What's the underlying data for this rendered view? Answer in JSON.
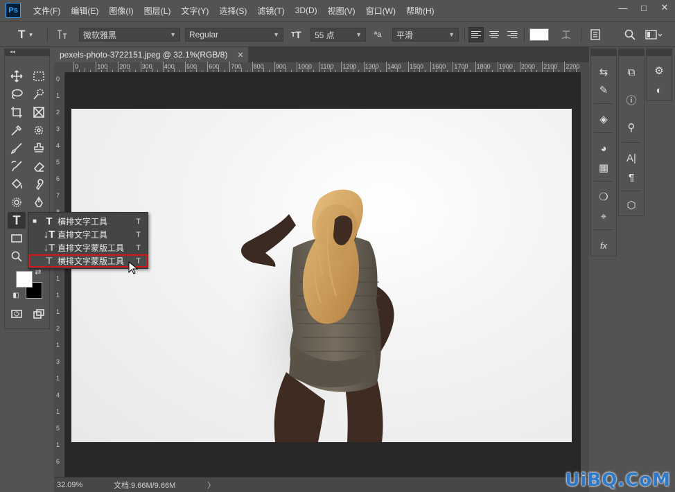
{
  "app": {
    "logo_text": "Ps"
  },
  "menu": [
    "文件(F)",
    "编辑(E)",
    "图像(I)",
    "图层(L)",
    "文字(Y)",
    "选择(S)",
    "滤镜(T)",
    "3D(D)",
    "视图(V)",
    "窗口(W)",
    "帮助(H)"
  ],
  "window_controls": {
    "minimize": "—",
    "maximize": "□",
    "close": "✕"
  },
  "options": {
    "tool_glyph": "T",
    "font_family": "微软雅黑",
    "font_style": "Regular",
    "font_size": "55 点",
    "antialias_glyph": "ªa",
    "antialias": "平滑",
    "text_color": "#ffffff"
  },
  "document": {
    "tab_title": "pexels-photo-3722151.jpeg @ 32.1%(RGB/8)",
    "close": "✕"
  },
  "ruler_h": [
    "0",
    "100",
    "200",
    "300",
    "400",
    "500",
    "600",
    "700",
    "800",
    "900",
    "1000",
    "1100",
    "1200",
    "1300",
    "1400",
    "1500",
    "1600",
    "1700",
    "1800",
    "1900",
    "2000",
    "2100",
    "2200"
  ],
  "ruler_v": [
    "0",
    "1",
    "2",
    "3",
    "4",
    "5",
    "6",
    "7",
    "8",
    "9",
    "1",
    "0",
    "1",
    "1",
    "1",
    "2",
    "1",
    "3",
    "1",
    "4",
    "1",
    "5",
    "1",
    "6"
  ],
  "flyout": {
    "items": [
      {
        "label": "横排文字工具",
        "key": "T",
        "current": true
      },
      {
        "label": "直排文字工具",
        "key": "T"
      },
      {
        "label": "直排文字蒙版工具",
        "key": "T"
      },
      {
        "label": "横排文字蒙版工具",
        "key": "T",
        "highlighted": true
      }
    ],
    "highlight_color": "#d0191c"
  },
  "colors": {
    "foreground": "#ffffff",
    "background": "#000000"
  },
  "status": {
    "zoom": "32.09%",
    "doc_info": "文档:9.66M/9.66M",
    "arrow": "〉"
  },
  "watermark": "UiBQ.CoM"
}
